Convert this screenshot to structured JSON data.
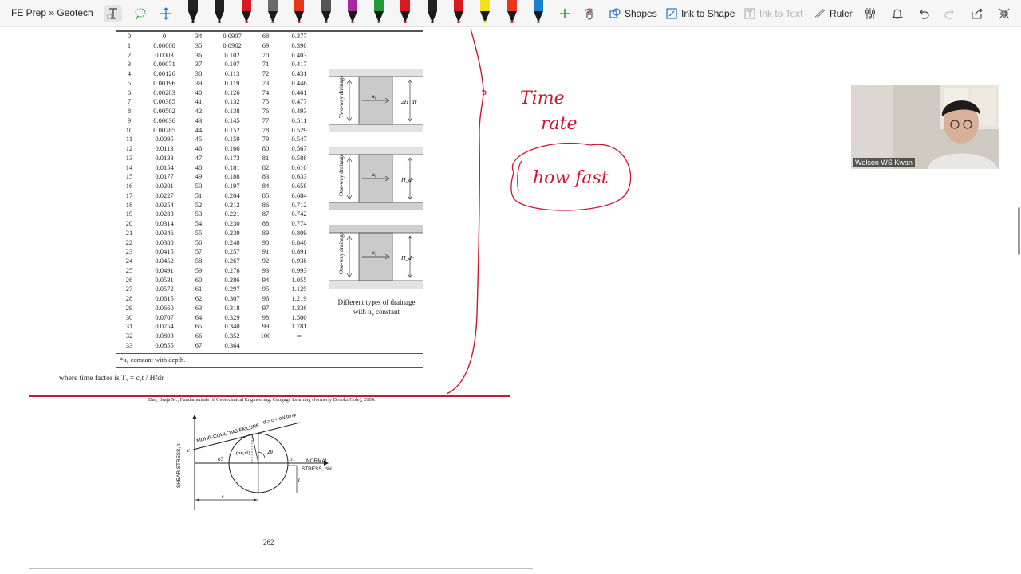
{
  "toolbar": {
    "breadcrumb": "FE Prep » Geotech",
    "shapes": "Shapes",
    "ink_to_shape": "Ink to Shape",
    "ink_to_text": "Ink to Text",
    "ruler": "Ruler",
    "pen_colors": [
      "#222222",
      "#222222",
      "#d81b22",
      "#6a6a6a",
      "#e7361c",
      "#555555",
      "#a7279c",
      "#1f9b3a",
      "#d81b22",
      "#222222",
      "#d81b22",
      "#f5e11a",
      "#e7361c",
      "#1a80d0"
    ],
    "accent_green": "#2e9e3f"
  },
  "table": {
    "rows": [
      [
        "0",
        "0",
        "34",
        "0.0907",
        "68",
        "0.377"
      ],
      [
        "1",
        "0.00008",
        "35",
        "0.0962",
        "69",
        "0.390"
      ],
      [
        "2",
        "0.0003",
        "36",
        "0.102",
        "70",
        "0.403"
      ],
      [
        "3",
        "0.00071",
        "37",
        "0.107",
        "71",
        "0.417"
      ],
      [
        "4",
        "0.00126",
        "38",
        "0.113",
        "72",
        "0.431"
      ],
      [
        "5",
        "0.00196",
        "39",
        "0.119",
        "73",
        "0.446"
      ],
      [
        "6",
        "0.00283",
        "40",
        "0.126",
        "74",
        "0.461"
      ],
      [
        "7",
        "0.00385",
        "41",
        "0.132",
        "75",
        "0.477"
      ],
      [
        "8",
        "0.00502",
        "42",
        "0.138",
        "76",
        "0.493"
      ],
      [
        "9",
        "0.00636",
        "43",
        "0.145",
        "77",
        "0.511"
      ],
      [
        "10",
        "0.00785",
        "44",
        "0.152",
        "78",
        "0.529"
      ],
      [
        "11",
        "0.0095",
        "45",
        "0.159",
        "79",
        "0.547"
      ],
      [
        "12",
        "0.0113",
        "46",
        "0.166",
        "80",
        "0.567"
      ],
      [
        "13",
        "0.0133",
        "47",
        "0.173",
        "81",
        "0.588"
      ],
      [
        "14",
        "0.0154",
        "48",
        "0.181",
        "82",
        "0.610"
      ],
      [
        "15",
        "0.0177",
        "49",
        "0.188",
        "83",
        "0.633"
      ],
      [
        "16",
        "0.0201",
        "50",
        "0.197",
        "84",
        "0.658"
      ],
      [
        "17",
        "0.0227",
        "51",
        "0.204",
        "85",
        "0.684"
      ],
      [
        "18",
        "0.0254",
        "52",
        "0.212",
        "86",
        "0.712"
      ],
      [
        "19",
        "0.0283",
        "53",
        "0.221",
        "87",
        "0.742"
      ],
      [
        "20",
        "0.0314",
        "54",
        "0.230",
        "88",
        "0.774"
      ],
      [
        "21",
        "0.0346",
        "55",
        "0.239",
        "89",
        "0.809"
      ],
      [
        "22",
        "0.0380",
        "56",
        "0.248",
        "90",
        "0.848"
      ],
      [
        "23",
        "0.0415",
        "57",
        "0.257",
        "91",
        "0.891"
      ],
      [
        "24",
        "0.0452",
        "58",
        "0.267",
        "92",
        "0.938"
      ],
      [
        "25",
        "0.0491",
        "59",
        "0.276",
        "93",
        "0.993"
      ],
      [
        "26",
        "0.0531",
        "60",
        "0.286",
        "94",
        "1.055"
      ],
      [
        "27",
        "0.0572",
        "61",
        "0.297",
        "95",
        "1.129"
      ],
      [
        "28",
        "0.0615",
        "62",
        "0.307",
        "96",
        "1.219"
      ],
      [
        "29",
        "0.0660",
        "63",
        "0.318",
        "97",
        "1.336"
      ],
      [
        "30",
        "0.0707",
        "64",
        "0.329",
        "98",
        "1.500"
      ],
      [
        "31",
        "0.0754",
        "65",
        "0.340",
        "99",
        "1.781"
      ],
      [
        "32",
        "0.0803",
        "66",
        "0.352",
        "100",
        "∞"
      ],
      [
        "33",
        "0.0855",
        "67",
        "0.364",
        "",
        ""
      ]
    ],
    "footnote": "*u₀ constant with depth."
  },
  "drainage": {
    "panels": [
      {
        "label": "Two-way drainage",
        "pressure": "u₀",
        "height": "2H_dr"
      },
      {
        "label": "One-way drainage",
        "pressure": "u₀",
        "height": "H_dr"
      },
      {
        "label": "One-way drainage",
        "pressure": "u₀",
        "height": "H_dr"
      }
    ],
    "caption_line1": "Different types of drainage",
    "caption_line2": "with u₀ constant"
  },
  "time_factor": "where time factor is Tᵥ = cᵥt / H²dr",
  "citation": "Das, Braja M., Fundamentals of Geotechnical Engineering, Cengage Learning (formerly Brooks/Cole), 2000.",
  "mohr": {
    "failure_label": "MOHR-COULOMB FAILURE",
    "failure_eq": "τf = c + σN tanφ",
    "y_axis": "SHEAR STRESS, τ",
    "x_axis_1": "NORMAL",
    "x_axis_2": "STRESS, σN",
    "c_label": "c",
    "sigma3": "σ3",
    "sigma1": "σ1",
    "point": "(σn,τf)",
    "angle": "2θ",
    "s_label": "s",
    "t_label": "t"
  },
  "page_number": "262",
  "annotations": {
    "line1": "Time",
    "line2": "rate",
    "boxed": "how fast",
    "ink_color": "#d0152c"
  },
  "video": {
    "name": "Welson WS Kwan"
  }
}
